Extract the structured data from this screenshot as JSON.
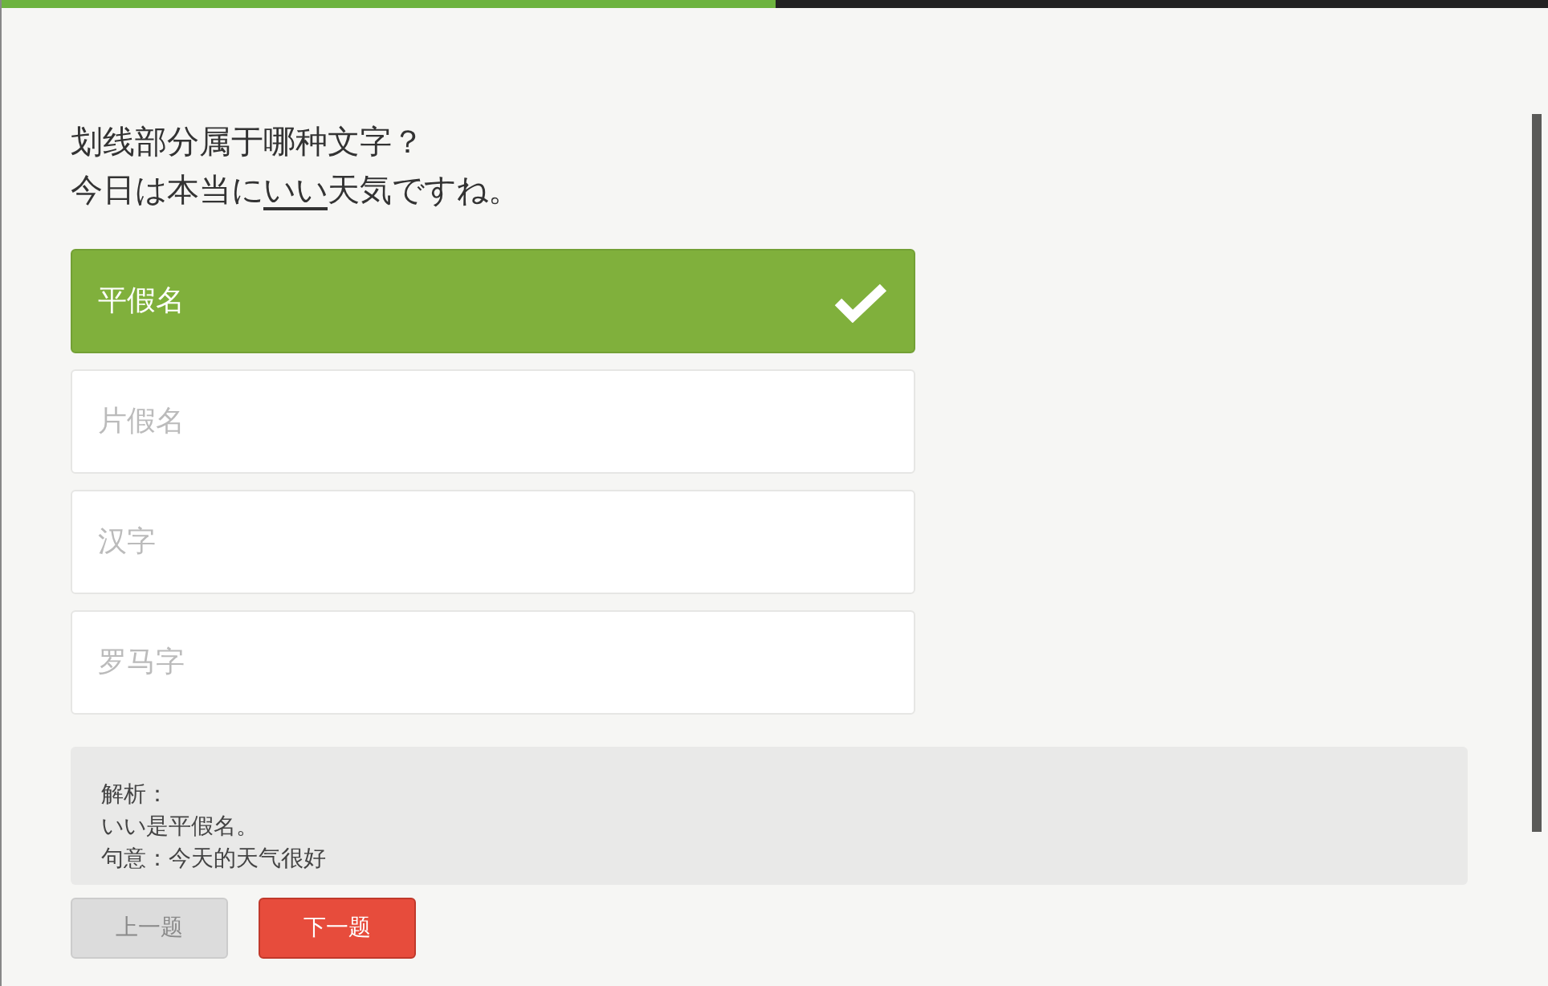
{
  "progress": {
    "level": 0.5
  },
  "question": {
    "prompt": "划线部分属于哪种文字？",
    "sentence": [
      {
        "text": "今日は本当に",
        "underlined": false
      },
      {
        "text": "いい",
        "underlined": true
      },
      {
        "text": "天気ですね。",
        "underlined": false
      }
    ]
  },
  "options": [
    {
      "label": "平假名",
      "selected": true
    },
    {
      "label": "片假名",
      "selected": false
    },
    {
      "label": "汉字",
      "selected": false
    },
    {
      "label": "罗马字",
      "selected": false
    }
  ],
  "explanation": [
    "解析：",
    "いい是平假名。",
    "句意：今天的天气很好"
  ],
  "buttons": [
    {
      "label": "上一题",
      "disabled": true,
      "kind": "prev"
    },
    {
      "label": "下一题",
      "disabled": false,
      "kind": "next"
    }
  ]
}
